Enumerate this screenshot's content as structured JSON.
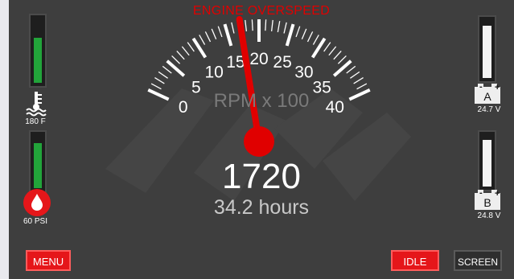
{
  "alert": {
    "text": "ENGINE OVERSPEED",
    "color": "#e00000"
  },
  "gauge": {
    "unit_label": "RPM x 100",
    "tick_labels": [
      "0",
      "5",
      "10",
      "15",
      "20",
      "25",
      "30",
      "35",
      "40"
    ],
    "min": 0,
    "max": 40,
    "needle_value": 17.2,
    "needle_color": "#e00000"
  },
  "readout": {
    "rpm": "1720",
    "hours": "34.2 hours"
  },
  "coolant": {
    "label": "180 F",
    "level": 0.7,
    "color": "#22a43a"
  },
  "oil": {
    "label": "60 PSI",
    "level": 0.85,
    "color": "#22a43a"
  },
  "battery_a": {
    "letter": "A",
    "label": "24.7 V",
    "level": 0.9,
    "color": "#f4f4f4"
  },
  "battery_b": {
    "letter": "B",
    "label": "24.8 V",
    "level": 0.9,
    "color": "#f4f4f4"
  },
  "buttons": {
    "menu": "MENU",
    "idle": "IDLE",
    "screen": "SCREEN"
  }
}
